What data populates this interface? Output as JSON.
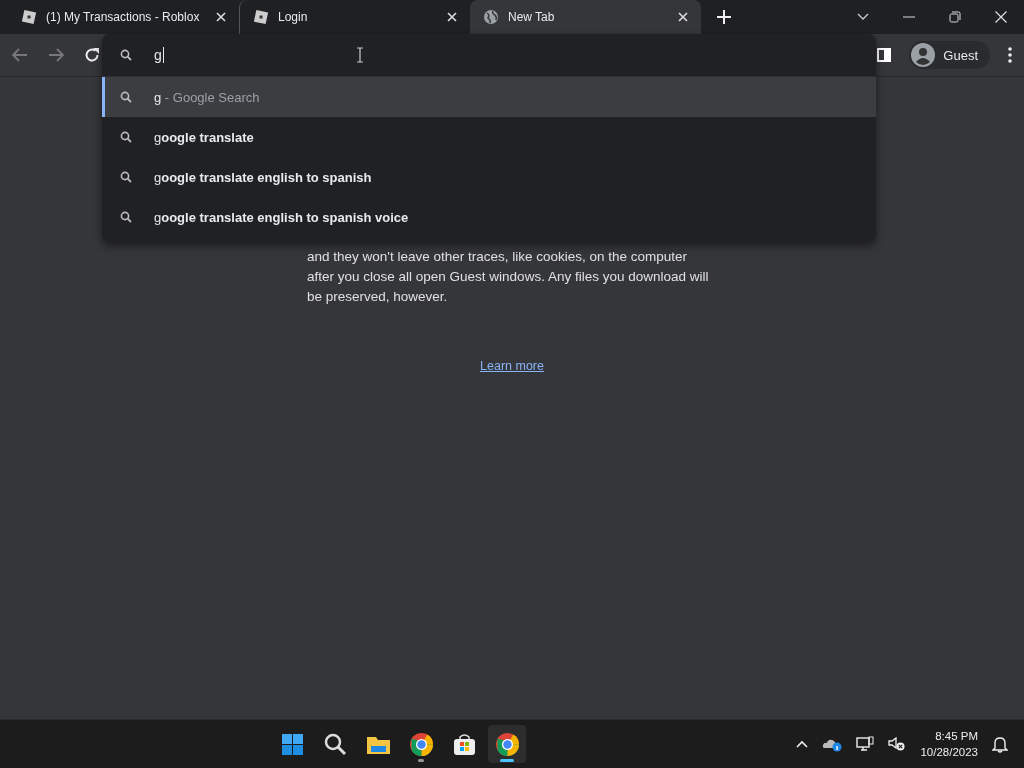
{
  "tabs": [
    {
      "title": "(1) My Transactions - Roblox",
      "kind": "site",
      "selected": false
    },
    {
      "title": "Login",
      "kind": "site",
      "selected": false
    },
    {
      "title": "New Tab",
      "kind": "newtab",
      "selected": true
    }
  ],
  "profile": {
    "label": "Guest"
  },
  "omnibox": {
    "value": "g",
    "suggestions": [
      {
        "text": "g",
        "hint": " - Google Search",
        "selected": true
      },
      {
        "text": "g**oogle translate**",
        "selected": false
      },
      {
        "text": "g**oogle translate english to spanish**",
        "selected": false
      },
      {
        "text": "g**oogle translate english to spanish voice**",
        "selected": false
      }
    ]
  },
  "content": {
    "paragraph": "and they won't leave other traces, like cookies, on the computer after you close all open Guest windows. Any files you download will be preserved, however.",
    "link": "Learn more"
  },
  "taskbar": {
    "apps": [
      {
        "kind": "start",
        "running": false,
        "active": false
      },
      {
        "kind": "search",
        "running": false,
        "active": false
      },
      {
        "kind": "folder",
        "running": false,
        "active": false
      },
      {
        "kind": "chrome",
        "running": true,
        "active": false
      },
      {
        "kind": "store",
        "running": false,
        "active": false
      },
      {
        "kind": "chrome",
        "running": true,
        "active": true
      }
    ],
    "time": "8:45 PM",
    "date": "10/28/2023"
  }
}
